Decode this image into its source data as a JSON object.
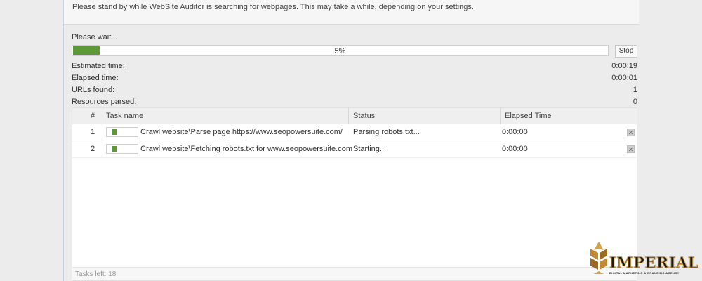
{
  "header": {
    "message": "Please stand by while WebSite Auditor is searching for webpages. This may take a while, depending on your settings."
  },
  "progress": {
    "label": "Please wait...",
    "percent": 5,
    "percent_text": "5%",
    "stop_label": "Stop"
  },
  "stats": [
    {
      "label": "Estimated time:",
      "value": "0:00:19"
    },
    {
      "label": "Elapsed time:",
      "value": "0:00:01"
    },
    {
      "label": "URLs found:",
      "value": "1"
    },
    {
      "label": "Resources parsed:",
      "value": "0"
    }
  ],
  "table": {
    "columns": [
      "#",
      "Task name",
      "Status",
      "Elapsed Time"
    ],
    "rows": [
      {
        "num": "1",
        "task": "Crawl website\\Parse page https://www.seopowersuite.com/",
        "status": "Parsing robots.txt...",
        "elapsed": "0:00:00"
      },
      {
        "num": "2",
        "task": "Crawl website\\Fetching robots.txt for www.seopowersuite.com",
        "status": "Starting...",
        "elapsed": "0:00:00"
      }
    ],
    "footer": "Tasks left: 18"
  },
  "logo": {
    "name": "IMPERIAL",
    "tagline": "DIGITAL MARKETING & BRANDING AGENCY",
    "colors": {
      "gold": "#d3a24a",
      "dark": "#1a1a1a"
    }
  },
  "colors": {
    "progress_fill": "#5c9a35"
  }
}
